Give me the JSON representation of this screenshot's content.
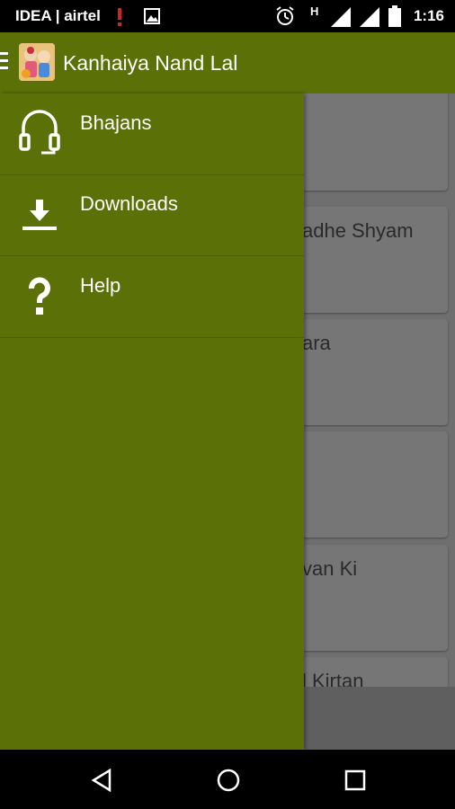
{
  "status_bar": {
    "carrier": "IDEA | airtel",
    "time": "1:16",
    "network_type": "H",
    "icons": [
      "signal-alert-icon",
      "image-icon",
      "alarm-icon",
      "signal-icon",
      "battery-icon"
    ]
  },
  "app_bar": {
    "title": "Kanhaiya Nand Lal",
    "menu_icon": "hamburger-icon",
    "color": "#5b7006"
  },
  "drawer": {
    "items": [
      {
        "label": "Bhajans",
        "icon": "headphones-icon"
      },
      {
        "label": "Downloads",
        "icon": "download-icon"
      },
      {
        "label": "Help",
        "icon": "question-icon"
      }
    ],
    "background": "#5b7006"
  },
  "content": {
    "cards": [
      {
        "text": ""
      },
      {
        "text": "adhe Shyam"
      },
      {
        "text": "ara"
      },
      {
        "text": ""
      },
      {
        "text": "van Ki"
      },
      {
        "text": "l Kirtan"
      }
    ]
  },
  "nav_bar": {
    "buttons": [
      "back-icon",
      "home-icon",
      "recents-icon"
    ]
  }
}
